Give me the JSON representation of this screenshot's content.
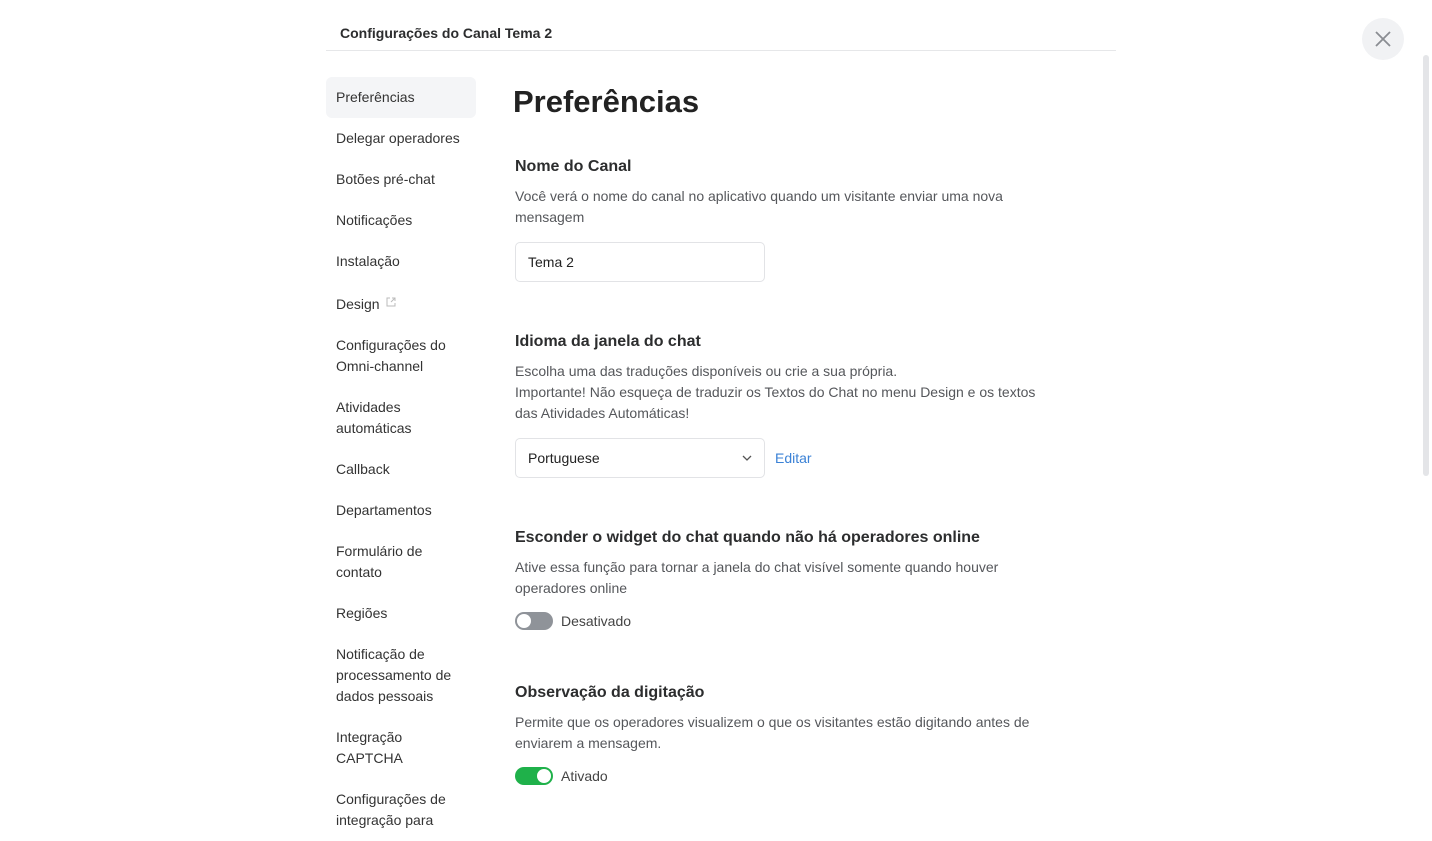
{
  "header": {
    "title": "Configurações do Canal Tema 2"
  },
  "sidebar": {
    "items": [
      {
        "label": "Preferências",
        "active": true
      },
      {
        "label": "Delegar operadores"
      },
      {
        "label": "Botões pré-chat"
      },
      {
        "label": "Notificações"
      },
      {
        "label": "Instalação"
      },
      {
        "label": "Design",
        "external": true
      },
      {
        "label": "Configurações do Omni-channel"
      },
      {
        "label": "Atividades automáticas"
      },
      {
        "label": "Callback"
      },
      {
        "label": "Departamentos"
      },
      {
        "label": "Formulário de contato"
      },
      {
        "label": "Regiões"
      },
      {
        "label": "Notificação de processamento de dados pessoais"
      },
      {
        "label": "Integração CAPTCHA"
      },
      {
        "label": "Configurações de integração para"
      }
    ]
  },
  "main": {
    "title": "Preferências",
    "channel_name": {
      "heading": "Nome do Canal",
      "description": "Você verá o nome do canal no aplicativo quando um visitante enviar uma nova mensagem",
      "value": "Tema 2"
    },
    "language": {
      "heading": "Idioma da janela do chat",
      "description1": "Escolha uma das traduções disponíveis ou crie a sua própria.",
      "description2": "Importante! Não esqueça de traduzir os Textos do Chat no menu Design e os textos das Atividades Automáticas!",
      "selected": "Portuguese",
      "edit_label": "Editar"
    },
    "hide_widget": {
      "heading": "Esconder o widget do chat quando não há operadores online",
      "description": "Ative essa função para tornar a janela do chat visível somente quando houver operadores online",
      "enabled": false,
      "state_label": "Desativado"
    },
    "typing": {
      "heading": "Observação da digitação",
      "description": "Permite que os operadores visualizem o que os visitantes estão digitando antes de enviarem a mensagem.",
      "enabled": true,
      "state_label": "Ativado"
    }
  },
  "colors": {
    "accent": "#3b82d6",
    "toggle_on": "#1fb14a",
    "toggle_off": "#8f9399"
  }
}
